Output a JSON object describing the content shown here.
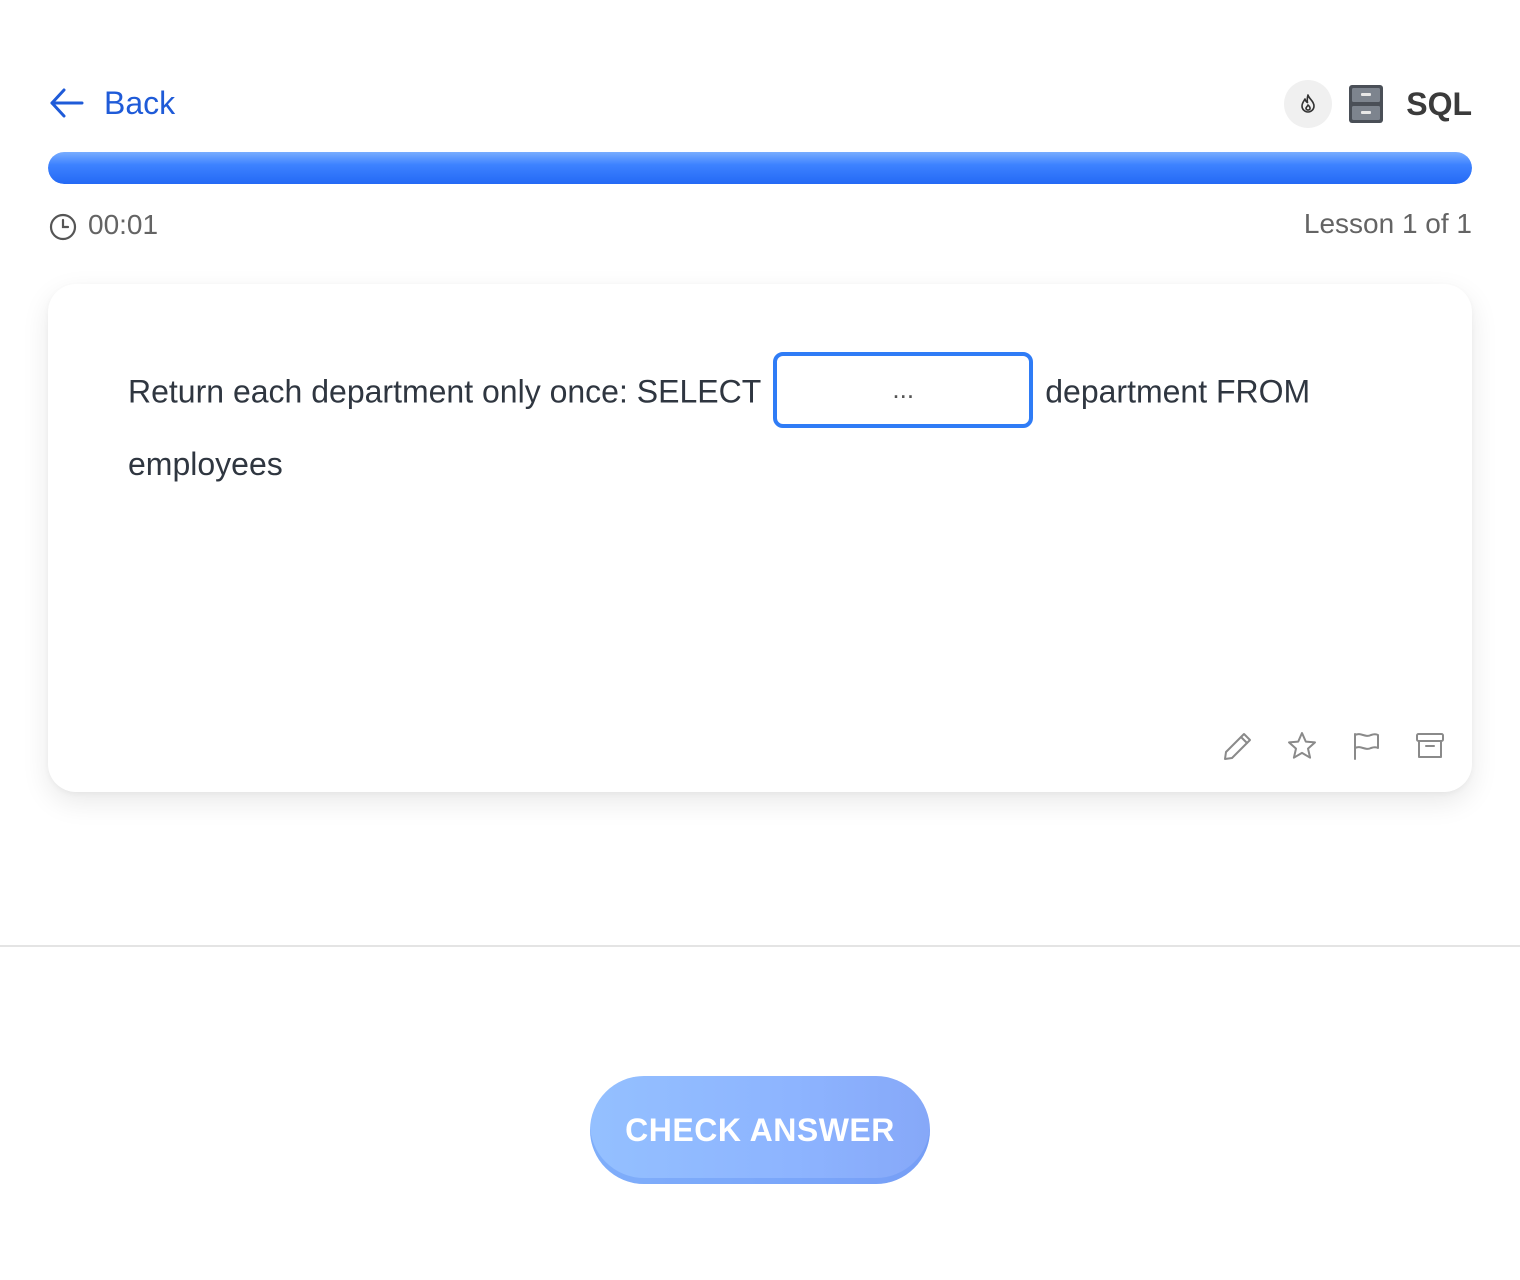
{
  "header": {
    "back_label": "Back",
    "course_title": "SQL",
    "streak_icon": "flame-icon",
    "course_icon": "file-cabinet-icon"
  },
  "progress": {
    "value": 1.0,
    "fill_color": "#2f7cf6"
  },
  "meta": {
    "timer": "00:01",
    "lesson": "Lesson 1 of 1"
  },
  "question": {
    "text_before": "Return each department only once: SELECT",
    "blank_placeholder": "...",
    "text_after": "department FROM employees"
  },
  "card_actions": [
    "pencil-icon",
    "star-icon",
    "flag-icon",
    "archive-icon"
  ],
  "footer": {
    "check_label": "CHECK ANSWER"
  },
  "colors": {
    "accent": "#2f7cf6",
    "link": "#1f5bd8",
    "button": "#8db4ff"
  }
}
